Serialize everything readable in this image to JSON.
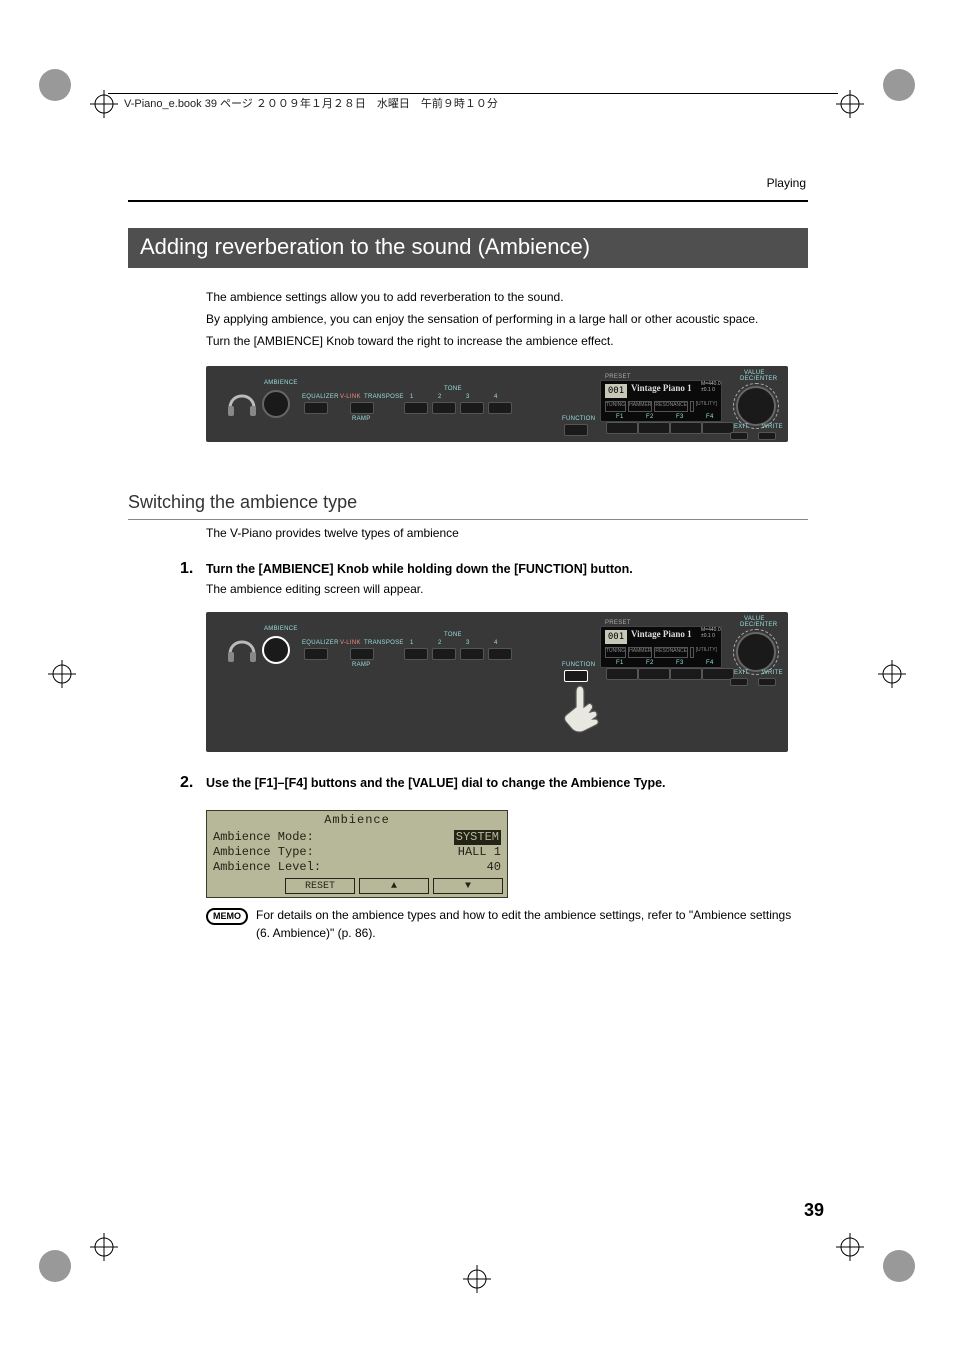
{
  "header": {
    "filename_line": "V-Piano_e.book  39 ページ  ２００９年１月２８日　水曜日　午前９時１０分",
    "section_label": "Playing"
  },
  "h1": "Adding reverberation to the sound (Ambience)",
  "intro": {
    "p1": "The ambience settings allow you to add reverberation to the sound.",
    "p2": "By applying ambience, you can enjoy the sensation of performing in a large hall or other acoustic space.",
    "p3": "Turn the [AMBIENCE] Knob toward the right to increase the ambience effect."
  },
  "panel": {
    "ambience": "AMBIENCE",
    "equalizer": "EQUALIZER",
    "transpose": "TRANSPOSE",
    "v_link": "V-LINK",
    "tone_nums": [
      "1",
      "2",
      "3",
      "4"
    ],
    "tone_title": "TONE",
    "ramp": "RAMP",
    "function": "FUNCTION",
    "display": {
      "preset": "PRESET",
      "num": "001",
      "title": "Vintage Piano 1",
      "top_right_a": "M=440.0",
      "top_right_b": "±0.1  0",
      "cols": [
        "TUNING",
        "HAMMER",
        "RESONANCE",
        "",
        "[UTILITY]"
      ]
    },
    "f_labels": [
      "F1",
      "F2",
      "F3",
      "F4"
    ],
    "value": "VALUE",
    "dec_enter": "DEC/ENTER",
    "exit": "EXIT",
    "write": "WRITE"
  },
  "h2": "Switching the ambience type",
  "sub_intro": "The V-Piano provides twelve types of ambience",
  "steps": {
    "s1_num": "1.",
    "s1_title": "Turn the [AMBIENCE] Knob while holding down the [FUNCTION] button.",
    "s1_text": "The ambience editing screen will appear.",
    "s2_num": "2.",
    "s2_title": "Use the [F1]–[F4] buttons and the [VALUE] dial to change the Ambience Type."
  },
  "lcd": {
    "title": "Ambience",
    "rows": [
      {
        "label": "Ambience Mode:",
        "value": "SYSTEM",
        "inv": true
      },
      {
        "label": "Ambience Type:",
        "value": "HALL 1",
        "inv": false
      },
      {
        "label": "Ambience Level:",
        "value": "40",
        "inv": false
      }
    ],
    "fn": [
      "",
      "RESET",
      "▲",
      "▼"
    ]
  },
  "memo": {
    "badge": "MEMO",
    "text": "For details on the ambience types and how to edit the ambience settings, refer to  \"Ambience settings (6. Ambience)\" (p. 86)."
  },
  "page_number": "39"
}
